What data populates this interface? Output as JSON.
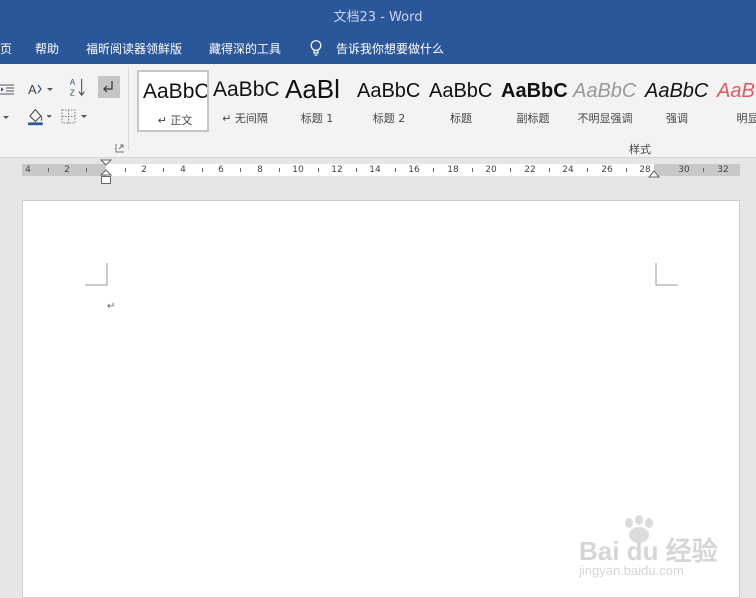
{
  "window": {
    "title": "文档23  -  Word"
  },
  "menu": {
    "items": [
      "页",
      "帮助",
      "福昕阅读器领鲜版",
      "藏得深的工具"
    ],
    "tell_me": "告诉我你想要做什么"
  },
  "ribbon": {
    "styles_group_label": "样式",
    "styles": [
      {
        "preview": "AaBbC",
        "label": "↵ 正文"
      },
      {
        "preview": "AaBbC",
        "label": "↵ 无间隔"
      },
      {
        "preview": "AaBl",
        "label": "标题 1"
      },
      {
        "preview": "AaBbC",
        "label": "标题 2"
      },
      {
        "preview": "AaBbC",
        "label": "标题"
      },
      {
        "preview": "AaBbC",
        "label": "副标题"
      },
      {
        "preview": "AaBbC",
        "label": "不明显强调"
      },
      {
        "preview": "AaBbC",
        "label": "强调"
      },
      {
        "preview": "AaB",
        "label": "明显强"
      }
    ]
  },
  "ruler": {
    "labels": [
      "4",
      "2",
      "2",
      "4",
      "6",
      "8",
      "10",
      "12",
      "14",
      "16",
      "18",
      "20",
      "22",
      "24",
      "26",
      "28",
      "30",
      "32"
    ]
  },
  "document": {
    "paragraph_mark": "↵"
  },
  "watermark": {
    "brand": "Bai du 经验",
    "url": "jingyan.baidu.com"
  }
}
